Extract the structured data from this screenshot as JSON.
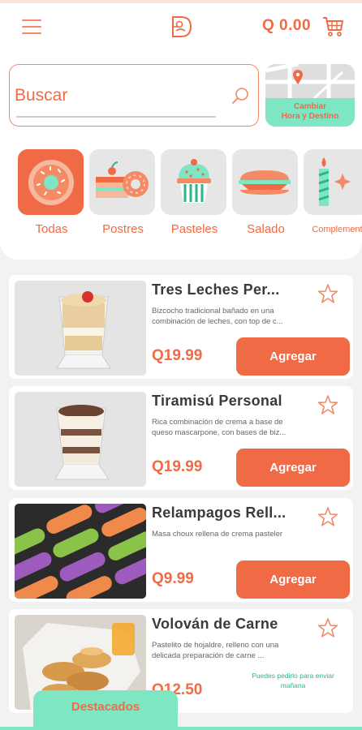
{
  "header": {
    "cart_total": "Q 0.00",
    "menu_icon": "hamburger-icon",
    "logo_icon": "brand-logo-icon",
    "cart_icon": "shopping-cart-icon"
  },
  "search": {
    "placeholder": "Buscar",
    "icon": "search-icon"
  },
  "location_button": {
    "line1": "Cambiar",
    "line2": "Hora y Destino",
    "icon": "map-pin-icon"
  },
  "categories": [
    {
      "label": "Todas",
      "icon": "donut-icon",
      "active": true
    },
    {
      "label": "Postres",
      "icon": "cake-slice-icon",
      "active": false
    },
    {
      "label": "Pasteles",
      "icon": "cupcake-icon",
      "active": false
    },
    {
      "label": "Salado",
      "icon": "sandwich-icon",
      "active": false
    },
    {
      "label": "Complement",
      "icon": "candle-icon",
      "active": false
    }
  ],
  "products": [
    {
      "name": "Tres Leches Per...",
      "description": "Bizcocho tradicional bañado en una combinación de leches, con top de c...",
      "price": "Q19.99",
      "button": "Agregar"
    },
    {
      "name": "Tiramisú Personal",
      "description": "Rica combinación de crema a base de queso mascarpone, con bases de biz...",
      "price": "Q19.99",
      "button": "Agregar"
    },
    {
      "name": "Relampagos Rell...",
      "description": "Masa choux rellena de crema pasteler",
      "price": "Q9.99",
      "button": "Agregar"
    },
    {
      "name": "Volován de Carne",
      "description": "Pastelito de hojaldre, relleno con una delicada preparación de carne ...",
      "price": "Q12.50",
      "note": "Puedes pedirlo para enviar mañana"
    }
  ],
  "bottom_tab": {
    "label": "Destacados"
  },
  "colors": {
    "accent": "#f06b45",
    "mint": "#7ee6c3",
    "tile": "#e6e6e6"
  }
}
